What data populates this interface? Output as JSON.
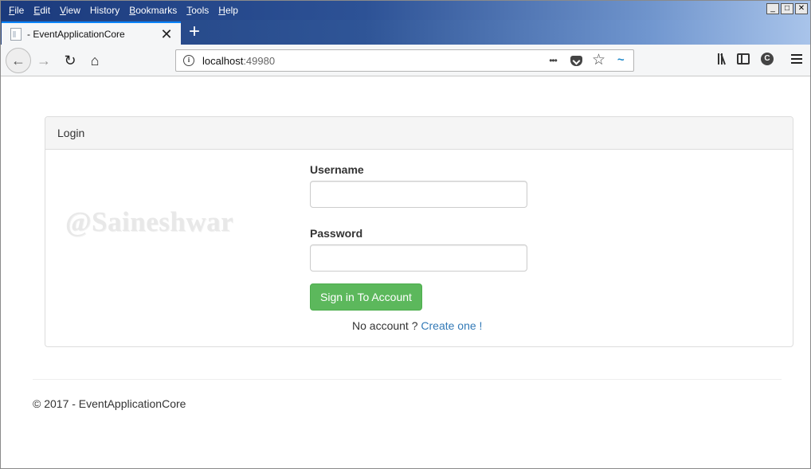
{
  "menu": {
    "items": [
      {
        "label": "File",
        "u": "F",
        "rest": "ile"
      },
      {
        "label": "Edit",
        "u": "E",
        "rest": "dit"
      },
      {
        "label": "View",
        "u": "V",
        "rest": "iew"
      },
      {
        "label": "History",
        "u": "",
        "rest": "History"
      },
      {
        "label": "Bookmarks",
        "u": "B",
        "rest": "ookmarks"
      },
      {
        "label": "Tools",
        "u": "T",
        "rest": "ools"
      },
      {
        "label": "Help",
        "u": "H",
        "rest": "elp"
      }
    ]
  },
  "window_controls": {
    "minimize": "_",
    "maximize": "□",
    "close": "✕"
  },
  "tab": {
    "title": "- EventApplicationCore",
    "close": "✕",
    "new_tab": "+"
  },
  "nav": {
    "back_icon": "←",
    "forward_icon": "→",
    "reload_icon": "↻",
    "home_icon": "⌂",
    "info_icon": "i",
    "url_host": "localhost",
    "url_port": ":49980",
    "more_icon": "•••",
    "star_icon": "☆",
    "extension_icon": "~",
    "sync_icon": "C"
  },
  "login": {
    "heading": "Login",
    "watermark": "@Saineshwar",
    "username_label": "Username",
    "username_value": "",
    "password_label": "Password",
    "password_value": "",
    "signin_label": "Sign in To Account",
    "noaccount_text": "No account ?",
    "create_link": "Create one !"
  },
  "footer": {
    "text": "© 2017 - EventApplicationCore"
  },
  "colors": {
    "accent": "#5cb85c",
    "link": "#337ab7",
    "tab_highlight": "#0a84ff"
  }
}
